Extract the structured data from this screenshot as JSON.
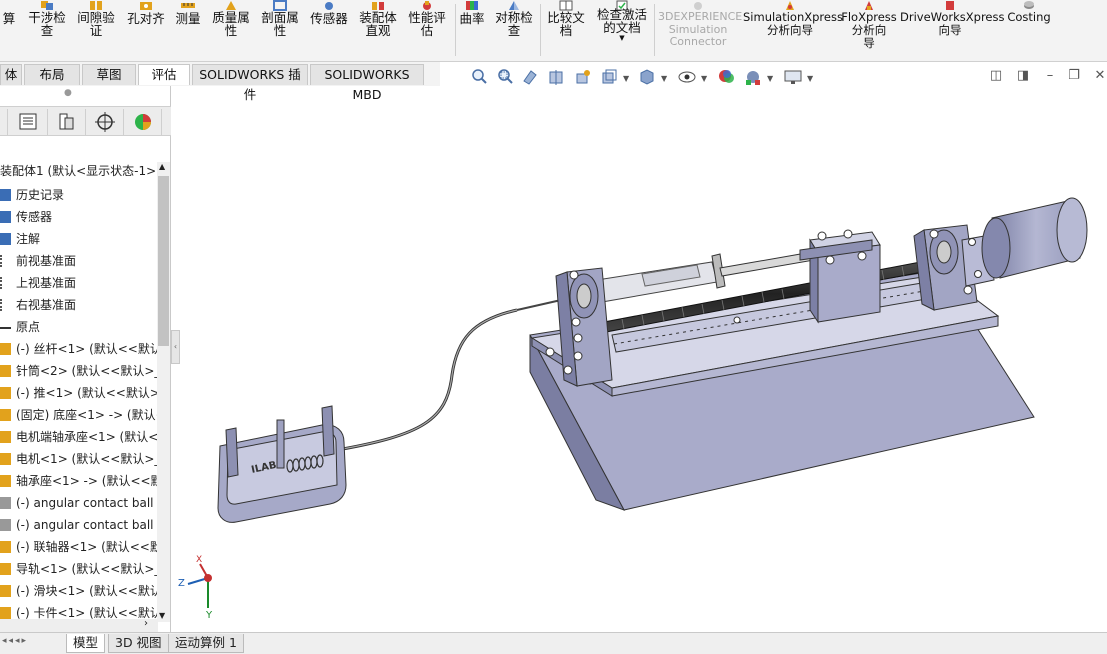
{
  "ribbon": {
    "buttons": [
      {
        "id": "calc",
        "label": "算"
      },
      {
        "id": "interference",
        "label": "干涉检\n查"
      },
      {
        "id": "clearance",
        "label": "间隙验\n证"
      },
      {
        "id": "hole_align",
        "label": "孔对齐"
      },
      {
        "id": "measure",
        "label": "测量"
      },
      {
        "id": "mass_props",
        "label": "质量属\n性"
      },
      {
        "id": "section_props",
        "label": "剖面属\n性"
      },
      {
        "id": "sensor",
        "label": "传感器"
      },
      {
        "id": "assembly_visual",
        "label": "装配体\n直观"
      },
      {
        "id": "performance",
        "label": "性能评\n估"
      },
      {
        "id": "curvature",
        "label": "曲率"
      },
      {
        "id": "symmetry",
        "label": "对称检\n查"
      },
      {
        "id": "compare",
        "label": "比较文\n档"
      },
      {
        "id": "check_active",
        "label": "检查激活\n的文档"
      },
      {
        "id": "exp_sim",
        "label": "3DEXPERIENCE\nSimulation\nConnector"
      },
      {
        "id": "simxpress",
        "label": "SimulationXpress\n分析向导"
      },
      {
        "id": "floxpress",
        "label": "FloXpress\n分析向\n导"
      },
      {
        "id": "driveworks",
        "label": "DriveWorksXpress\n向导"
      },
      {
        "id": "costing",
        "label": "Costing"
      }
    ]
  },
  "tabs": [
    "体",
    "布局",
    "草图",
    "评估",
    "SOLIDWORKS 插件",
    "SOLIDWORKS MBD"
  ],
  "tree": {
    "root": "装配体1 (默认<显示状态-1>)",
    "items": [
      "历史记录",
      "传感器",
      "注解",
      "前视基准面",
      "上视基准面",
      "右视基准面",
      "原点",
      "(-) 丝杆<1> (默认<<默认",
      "针筒<2> (默认<<默认>_",
      "(-) 推<1> (默认<<默认>_",
      "(固定) 底座<1> -> (默认<",
      "电机端轴承座<1> (默认<",
      "电机<1> (默认<<默认>_",
      "轴承座<1> -> (默认<<默",
      "(-) angular contact ball b",
      "(-) angular contact ball b",
      "(-) 联轴器<1> (默认<<默",
      "导轨<1> (默认<<默认>_",
      "(-) 滑块<1> (默认<<默认",
      "(-) 卡件<1> (默认<<默认"
    ]
  },
  "bottom_tabs": [
    "模型",
    "3D 视图",
    "运动算例 1"
  ],
  "axis": {
    "x": "Z",
    "y": "Y",
    "z": "X"
  },
  "part_engraving": "ILAB",
  "colors": {
    "accent": "#1e5fb3",
    "part": "#a6a8c6",
    "motor": "#9fa2c2"
  }
}
